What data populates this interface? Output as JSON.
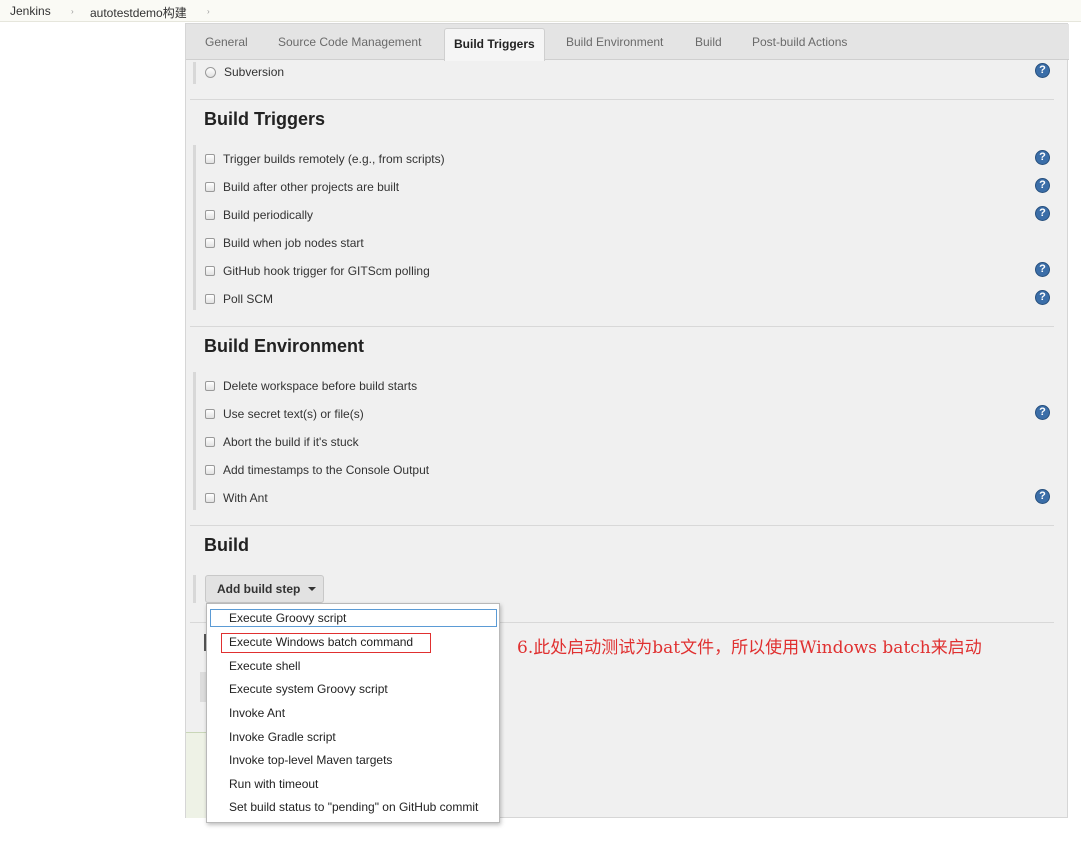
{
  "breadcrumb": {
    "items": [
      "Jenkins",
      "autotestdemo构建"
    ],
    "separator": "›"
  },
  "tabs": [
    {
      "label": "General",
      "active": false
    },
    {
      "label": "Source Code Management",
      "active": false
    },
    {
      "label": "Build Triggers",
      "active": true
    },
    {
      "label": "Build Environment",
      "active": false
    },
    {
      "label": "Build",
      "active": false
    },
    {
      "label": "Post-build Actions",
      "active": false
    }
  ],
  "scm": {
    "subversion_label": "Subversion"
  },
  "build_triggers": {
    "title": "Build Triggers",
    "options": [
      {
        "label": "Trigger builds remotely (e.g., from scripts)",
        "checked": false,
        "help": true
      },
      {
        "label": "Build after other projects are built",
        "checked": false,
        "help": true
      },
      {
        "label": "Build periodically",
        "checked": false,
        "help": true
      },
      {
        "label": "Build when job nodes start",
        "checked": false,
        "help": false
      },
      {
        "label": "GitHub hook trigger for GITScm polling",
        "checked": false,
        "help": true
      },
      {
        "label": "Poll SCM",
        "checked": false,
        "help": true
      }
    ]
  },
  "build_environment": {
    "title": "Build Environment",
    "options": [
      {
        "label": "Delete workspace before build starts",
        "checked": false,
        "help": false
      },
      {
        "label": "Use secret text(s) or file(s)",
        "checked": false,
        "help": true
      },
      {
        "label": "Abort the build if it's stuck",
        "checked": false,
        "help": false
      },
      {
        "label": "Add timestamps to the Console Output",
        "checked": false,
        "help": false
      },
      {
        "label": "With Ant",
        "checked": false,
        "help": true
      }
    ]
  },
  "build": {
    "title": "Build",
    "add_step_label": "Add build step"
  },
  "help_glyph": "?",
  "dropdown": {
    "items": [
      "Execute Groovy script",
      "Execute Windows batch command",
      "Execute shell",
      "Execute system Groovy script",
      "Invoke Ant",
      "Invoke Gradle script",
      "Invoke top-level Maven targets",
      "Run with timeout",
      "Set build status to \"pending\" on GitHub commit"
    ],
    "focused_index": 0,
    "highlighted_index": 1
  },
  "annotation": {
    "text": "6.此处启动测试为bat文件，所以使用Windows batch来启动",
    "color": "#e03030"
  }
}
